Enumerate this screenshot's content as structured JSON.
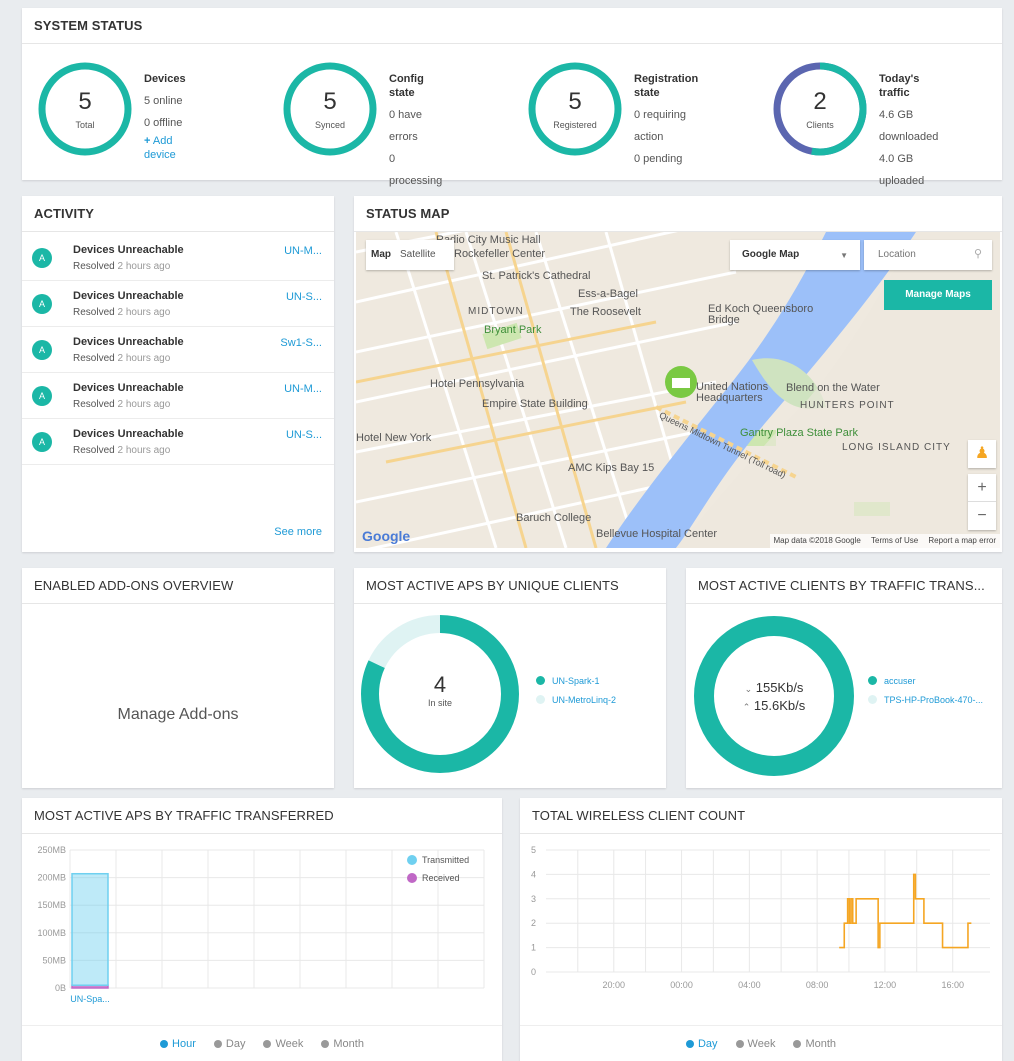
{
  "system_status": {
    "title": "SYSTEM STATUS",
    "stats": [
      {
        "ring_value": "5",
        "ring_label": "Total",
        "heading": "Devices",
        "line1": "5 online",
        "line2": "0 offline",
        "action": "Add device",
        "action_icon": "plus-icon",
        "fraction": 1.0
      },
      {
        "ring_value": "5",
        "ring_label": "Synced",
        "heading": "Config state",
        "line1": "0 have errors",
        "line2": "0 processing",
        "fraction": 1.0
      },
      {
        "ring_value": "5",
        "ring_label": "Registered",
        "heading": "Registration state",
        "line1": "0 requiring action",
        "line2": "0 pending",
        "fraction": 1.0
      },
      {
        "ring_value": "2",
        "ring_label": "Clients",
        "heading": "Today's traffic",
        "line1": "4.6 GB downloaded",
        "line2": "4.0 GB uploaded",
        "fraction": 0.53
      }
    ],
    "colors": {
      "ring": "#1bb7a6",
      "ring_upload": "#5b66b0"
    }
  },
  "activity": {
    "title": "ACTIVITY",
    "items": [
      {
        "avatar": "A",
        "title": "Devices Unreachable",
        "status": "Resolved",
        "time": "2 hours ago",
        "device": "UN-M..."
      },
      {
        "avatar": "A",
        "title": "Devices Unreachable",
        "status": "Resolved",
        "time": "2 hours ago",
        "device": "UN-S..."
      },
      {
        "avatar": "A",
        "title": "Devices Unreachable",
        "status": "Resolved",
        "time": "2 hours ago",
        "device": "Sw1-S..."
      },
      {
        "avatar": "A",
        "title": "Devices Unreachable",
        "status": "Resolved",
        "time": "2 hours ago",
        "device": "UN-M..."
      },
      {
        "avatar": "A",
        "title": "Devices Unreachable",
        "status": "Resolved",
        "time": "2 hours ago",
        "device": "UN-S..."
      }
    ],
    "see_more": "See more"
  },
  "status_map": {
    "title": "STATUS MAP",
    "map_btn": "Map",
    "satellite_btn": "Satellite",
    "map_type": "Google Map",
    "location_placeholder": "Location",
    "manage_maps": "Manage Maps",
    "zoom_in": "+",
    "zoom_out": "−",
    "google_logo": "Google",
    "attribution": "Map data ©2018 Google",
    "terms": "Terms of Use",
    "report": "Report a map error",
    "labels": [
      "Radio City Music Hall",
      "Rockefeller Center",
      "St. Patrick's Cathedral",
      "Ess-a-Bagel",
      "MIDTOWN",
      "The Roosevelt",
      "Bryant Park",
      "Ed Koch Queensboro Bridge",
      "Hotel Pennsylvania",
      "Empire State Building",
      "United Nations Headquarters",
      "Blend on the Water",
      "HUNTERS POINT",
      "Hotel New York",
      "Queens Midtown Tunnel (Toll road)",
      "Gantry Plaza State Park",
      "LONG ISLAND CITY",
      "AMC Kips Bay 15",
      "Baruch College",
      "Bellevue Hospital Center"
    ]
  },
  "addons": {
    "title": "ENABLED ADD-ONS OVERVIEW",
    "manage": "Manage Add-ons"
  },
  "aps_unique": {
    "title": "MOST ACTIVE APS BY UNIQUE CLIENTS",
    "center_value": "4",
    "center_label": "In site",
    "series": [
      {
        "name": "UN-Spark-1",
        "color": "#1bb7a6",
        "fraction": 0.82
      },
      {
        "name": "UN-MetroLinq-2",
        "color": "#dff3f3",
        "fraction": 0.18
      }
    ]
  },
  "clients_traffic": {
    "title": "MOST ACTIVE CLIENTS BY TRAFFIC TRANS...",
    "down": "155Kb/s",
    "up": "15.6Kb/s",
    "down_icon": "chevron-down-icon",
    "up_icon": "chevron-up-icon",
    "series": [
      {
        "name": "accuser",
        "color": "#1bb7a6",
        "fraction": 1.0
      },
      {
        "name": "TPS-HP-ProBook-470-...",
        "color": "#dff3f3",
        "fraction": 0.0
      }
    ]
  },
  "aps_traffic": {
    "title": "MOST ACTIVE APS BY TRAFFIC TRANSFERRED",
    "tabs": [
      "Hour",
      "Day",
      "Week",
      "Month"
    ],
    "active_tab": "Hour"
  },
  "wireless_count": {
    "title": "TOTAL WIRELESS CLIENT COUNT",
    "tabs": [
      "Day",
      "Week",
      "Month"
    ],
    "active_tab": "Day"
  },
  "chart_data": [
    {
      "type": "bar",
      "title": "",
      "categories": [
        "UN-Spa..."
      ],
      "series": [
        {
          "name": "Received",
          "color": "#c068c6",
          "values": [
            5
          ]
        },
        {
          "name": "Transmitted",
          "color": "#6fd0f0",
          "values": [
            202
          ]
        }
      ],
      "ylim": [
        0,
        250
      ],
      "yticks": [
        "0B",
        "50MB",
        "100MB",
        "150MB",
        "200MB",
        "250MB"
      ],
      "xlabel": "",
      "ylabel": "",
      "stacked": true,
      "legend": "top-right",
      "grid": true
    },
    {
      "type": "line",
      "title": "",
      "color": "#f5a623",
      "xticks": [
        "20:00",
        "00:00",
        "04:00",
        "08:00",
        "12:00",
        "16:00"
      ],
      "ylim": [
        0,
        5
      ],
      "yticks": [
        "0",
        "1",
        "2",
        "3",
        "4",
        "5"
      ],
      "grid": true,
      "series": [
        {
          "step": true,
          "x": [
            9.3,
            9.6,
            9.8,
            9.9,
            10.0,
            10.1,
            10.3,
            11.5,
            11.6,
            11.7,
            12.5,
            13.7,
            13.8,
            14.0,
            14.3,
            14.6,
            15.4,
            16.9,
            17.1
          ],
          "y": [
            1,
            2,
            3,
            2,
            3,
            2,
            3,
            3,
            1,
            2,
            2,
            4,
            3,
            3,
            2,
            2,
            1,
            2,
            2
          ]
        }
      ]
    }
  ]
}
